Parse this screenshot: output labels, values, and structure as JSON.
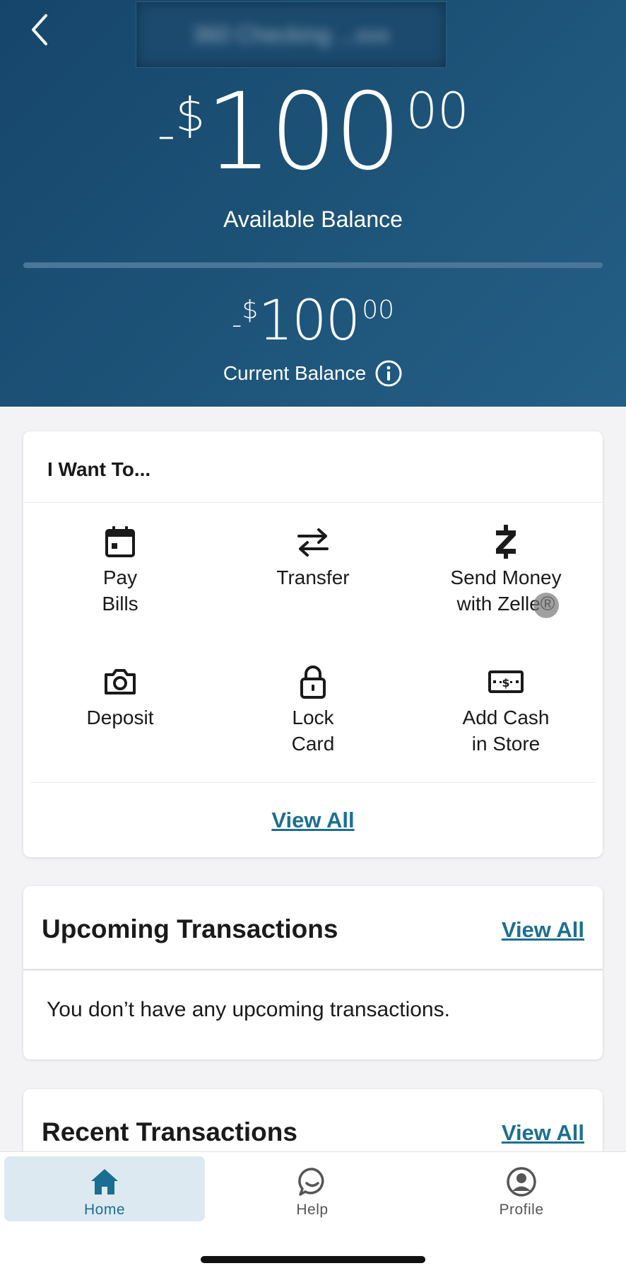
{
  "header": {
    "account_name": "360 Checking ...xxx",
    "available_balance": {
      "sign": "-",
      "dollar_symbol": "$",
      "whole": "100",
      "cents": "00",
      "label": "Available Balance"
    },
    "current_balance": {
      "sign": "-",
      "dollar_symbol": "$",
      "whole": "100",
      "cents": "00",
      "label": "Current Balance"
    }
  },
  "want_to": {
    "title": "I Want To...",
    "actions": [
      {
        "label": "Pay\nBills",
        "icon": "calendar-icon"
      },
      {
        "label": "Transfer",
        "icon": "transfer-arrows-icon"
      },
      {
        "label": "Send Money\nwith Zelle®",
        "icon": "zelle-icon"
      },
      {
        "label": "Deposit",
        "icon": "camera-icon"
      },
      {
        "label": "Lock\nCard",
        "icon": "lock-icon"
      },
      {
        "label": "Add Cash\nin Store",
        "icon": "cash-icon"
      }
    ],
    "view_all": "View All"
  },
  "upcoming": {
    "title": "Upcoming Transactions",
    "view_all": "View All",
    "empty_message": "You don’t have any upcoming transactions."
  },
  "recent": {
    "title": "Recent Transactions",
    "view_all": "View All"
  },
  "tabbar": {
    "tabs": [
      {
        "label": "Home",
        "icon": "home-icon",
        "active": true
      },
      {
        "label": "Help",
        "icon": "chat-bubble-icon",
        "active": false
      },
      {
        "label": "Profile",
        "icon": "user-icon",
        "active": false
      }
    ]
  },
  "colors": {
    "header_bg": "#1e5479",
    "link": "#1d6f91",
    "active_tab_bg": "#dde9f1"
  }
}
